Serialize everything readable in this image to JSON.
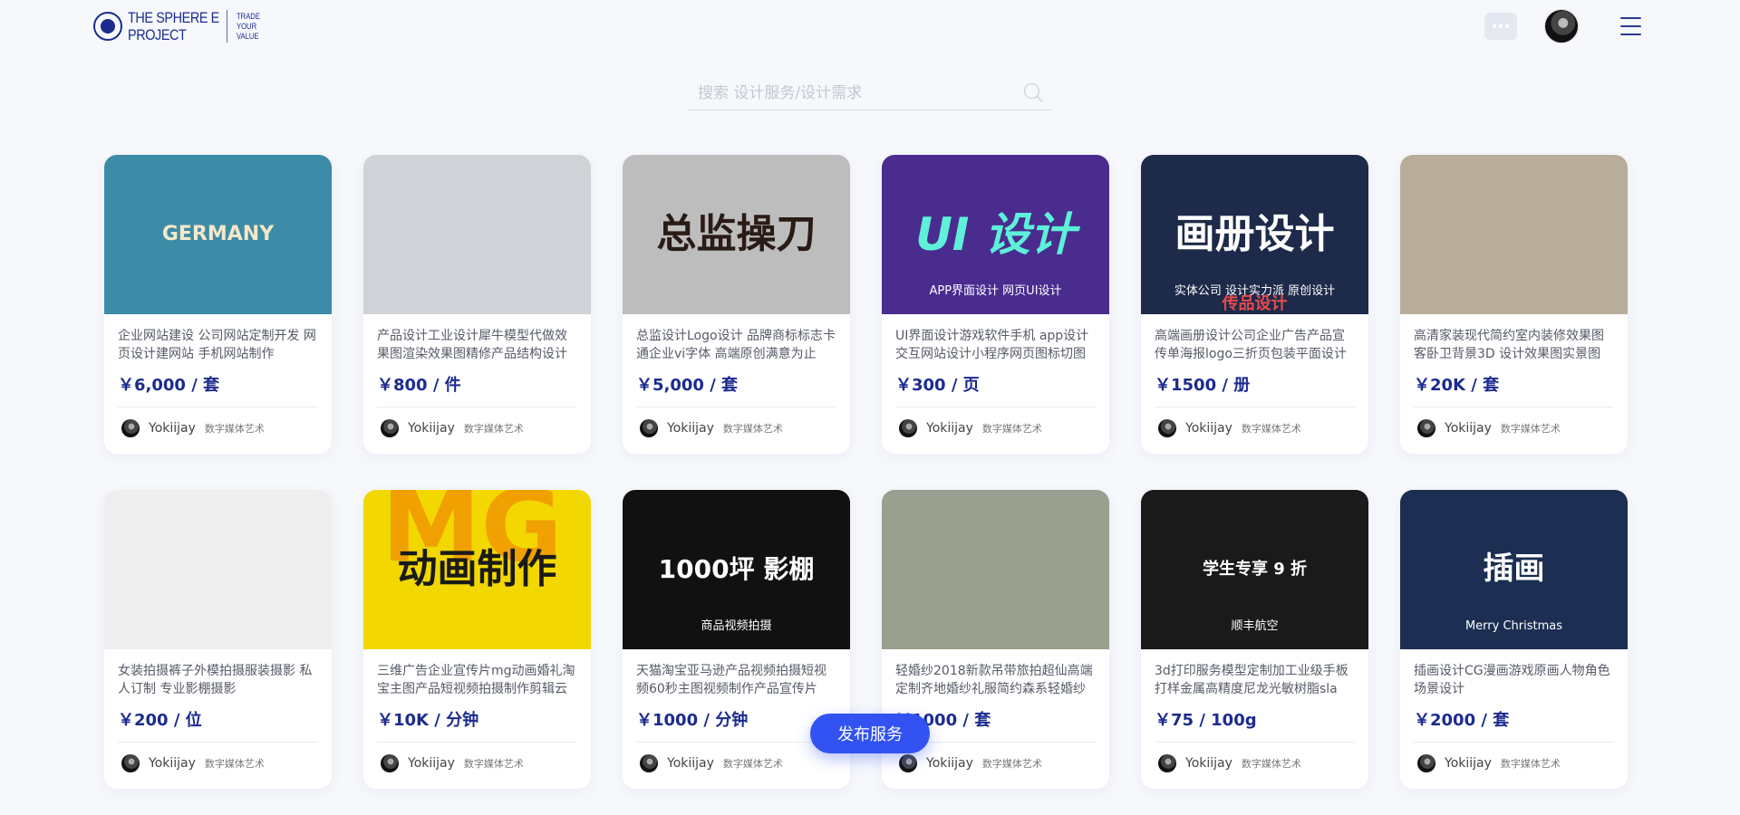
{
  "brand": {
    "name_line1": "THE SPHERE E",
    "name_line2": "PROJECT",
    "tag_line1": "TRADE",
    "tag_line2": "YOUR",
    "tag_line3": "VALUE",
    "accent": "#1b2b8f"
  },
  "header": {
    "messages_icon": "chat-dots-icon",
    "menu_icon": "hamburger-icon"
  },
  "search": {
    "placeholder": "搜索 设计服务/设计需求",
    "value": ""
  },
  "cards": [
    {
      "title": "企业网站建设 公司网站定制开发 网页设计建网站 手机网站制作",
      "price": "￥6,000 / 套",
      "user": "Yokiijay",
      "tag": "数字媒体艺术",
      "thumb_label": "GERMANY",
      "thumb_bg": "#3c8ca8"
    },
    {
      "title": "产品设计工业设计犀牛模型代做效果图渲染效果图精修产品结构设计",
      "price": "￥800 / 件",
      "user": "Yokiijay",
      "tag": "数字媒体艺术",
      "thumb_label": "",
      "thumb_bg": "#cfd2d6"
    },
    {
      "title": "总监设计Logo设计 品牌商标标志卡通企业vi字体 高端原创满意为止",
      "price": "￥5,000 / 套",
      "user": "Yokiijay",
      "tag": "数字媒体艺术",
      "thumb_label": "总监操刀",
      "thumb_bg": "#bdbdbd"
    },
    {
      "title": "UI界面设计游戏软件手机 app设计交互网站设计小程序网页图标切图",
      "price": "￥300 / 页",
      "user": "Yokiijay",
      "tag": "数字媒体艺术",
      "thumb_label": "UI 设计",
      "thumb_sub": "APP界面设计  网页UI设计",
      "thumb_bg": "#4a2c8f"
    },
    {
      "title": "高端画册设计公司企业广告产品宣传单海报logo三折页包装平面设计",
      "price": "￥1500 / 册",
      "user": "Yokiijay",
      "tag": "数字媒体艺术",
      "thumb_label": "画册设计",
      "thumb_sub": "实体公司  设计实力派  原创设计",
      "thumb_sub2": "传品设计",
      "thumb_bg": "#1d2a4a"
    },
    {
      "title": "高清家装现代简约室内装修效果图客卧卫背景3D 设计效果图实景图",
      "price": "￥20K / 套",
      "user": "Yokiijay",
      "tag": "数字媒体艺术",
      "thumb_label": "",
      "thumb_bg": "#b7ad9a"
    },
    {
      "title": "女装拍摄裤子外模拍摄服装摄影 私人订制 专业影棚摄影",
      "price": "￥200 / 位",
      "user": "Yokiijay",
      "tag": "数字媒体艺术",
      "thumb_label": "",
      "thumb_bg": "#eeeeee"
    },
    {
      "title": "三维广告企业宣传片mg动画婚礼淘宝主图产品短视频拍摄制作剪辑云",
      "price": "￥10K / 分钟",
      "user": "Yokiijay",
      "tag": "数字媒体艺术",
      "thumb_label": "动画制作",
      "thumb_sub": "MG",
      "thumb_bg": "#f2d700"
    },
    {
      "title": "天猫淘宝亚马逊产品视频拍摄短视频60秒主图视频制作产品宣传片",
      "price": "￥1000 / 分钟",
      "user": "Yokiijay",
      "tag": "数字媒体艺术",
      "thumb_label": "1000坪 影棚",
      "thumb_sub": "商品视频拍摄",
      "thumb_bg": "#111111"
    },
    {
      "title": "轻婚纱2018新款吊带旅拍超仙高端定制齐地婚纱礼服简约森系轻婚纱",
      "price": "￥1000 / 套",
      "user": "Yokiijay",
      "tag": "数字媒体艺术",
      "thumb_label": "",
      "thumb_bg": "#9aa08f"
    },
    {
      "title": "3d打印服务模型定制加工业级手板打样金属高精度尼龙光敏树脂sla",
      "price": "￥75 / 100g",
      "user": "Yokiijay",
      "tag": "数字媒体艺术",
      "thumb_label": "学生专享 9 折",
      "thumb_sub": "顺丰航空",
      "thumb_bg": "#1a1a1a"
    },
    {
      "title": "插画设计CG漫画游戏原画人物角色场景设计",
      "price": "￥2000 / 套",
      "user": "Yokiijay",
      "tag": "数字媒体艺术",
      "thumb_label": "插画",
      "thumb_sub": "Merry Christmas",
      "thumb_bg": "#1c2f52"
    }
  ],
  "publish_button": "发布服务"
}
